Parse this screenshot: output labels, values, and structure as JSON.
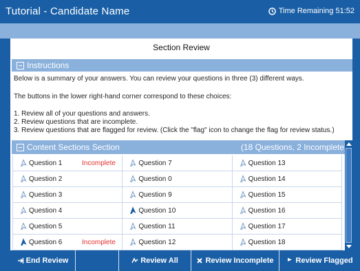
{
  "header": {
    "title": "Tutorial - Candidate Name",
    "time_remaining": "Time Remaining 51:52"
  },
  "page_title": "Section Review",
  "instructions": {
    "heading": "Instructions",
    "line1": "Below is a summary of your answers. You can review your questions in three (3) different ways.",
    "line2": "The buttons in the lower right-hand corner correspond to these choices:",
    "item1": "1. Review all of your questions and answers.",
    "item2": "2. Review questions that are incomplete.",
    "item3": "3. Review questions that are flagged for review. (Click the \"flag\" icon to change the flag for review status.)"
  },
  "content_section": {
    "heading": "Content Sections Section",
    "summary": "(18 Questions, 2 Incomplete)",
    "incomplete_color": "#e03030",
    "flag_color": "#1a5fa6",
    "questions": [
      {
        "label": "Question 1",
        "status": "Incomplete",
        "flagged": false
      },
      {
        "label": "Question 2",
        "status": "",
        "flagged": false
      },
      {
        "label": "Question 3",
        "status": "",
        "flagged": false
      },
      {
        "label": "Question 4",
        "status": "",
        "flagged": false
      },
      {
        "label": "Question 5",
        "status": "",
        "flagged": false
      },
      {
        "label": "Question 6",
        "status": "Incomplete",
        "flagged": true
      },
      {
        "label": "Question 7",
        "status": "",
        "flagged": false
      },
      {
        "label": "Question 0",
        "status": "",
        "flagged": false
      },
      {
        "label": "Question 9",
        "status": "",
        "flagged": false
      },
      {
        "label": "Question 10",
        "status": "",
        "flagged": true
      },
      {
        "label": "Question 11",
        "status": "",
        "flagged": false
      },
      {
        "label": "Question 12",
        "status": "",
        "flagged": false
      },
      {
        "label": "Question 13",
        "status": "",
        "flagged": false
      },
      {
        "label": "Question 14",
        "status": "",
        "flagged": false
      },
      {
        "label": "Question 15",
        "status": "",
        "flagged": false
      },
      {
        "label": "Question 16",
        "status": "",
        "flagged": false
      },
      {
        "label": "Question 17",
        "status": "",
        "flagged": false
      },
      {
        "label": "Question 18",
        "status": "",
        "flagged": false
      }
    ]
  },
  "footer": {
    "end_review": "End Review",
    "review_all": "Review All",
    "review_incomplete": "Review Incomplete",
    "review_flagged": "Review Flagged"
  }
}
